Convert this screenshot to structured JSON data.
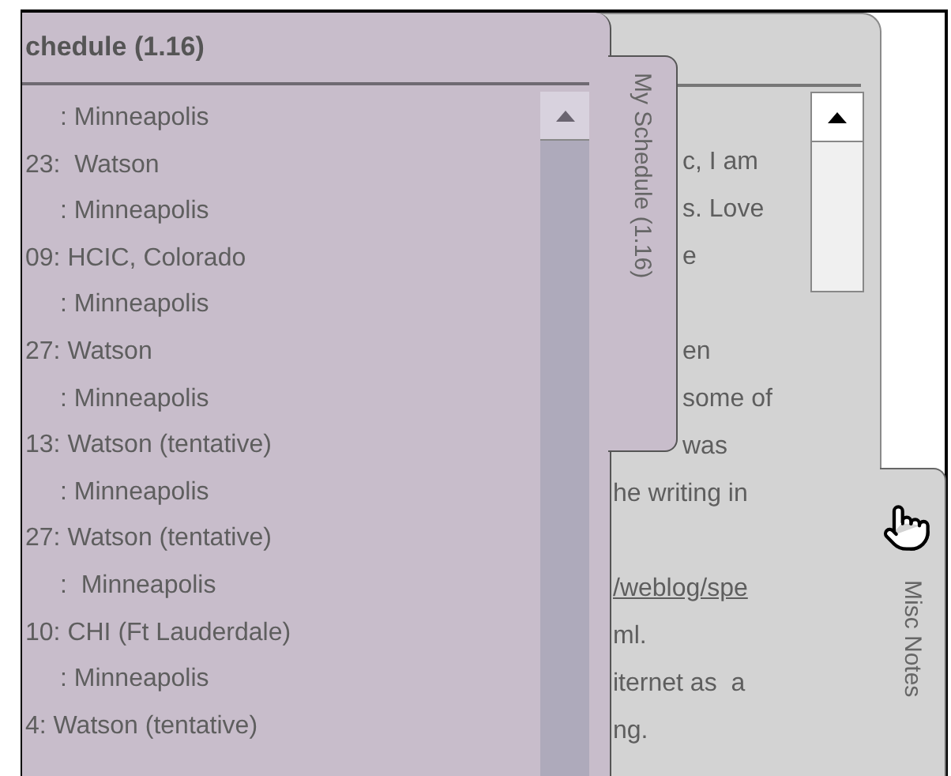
{
  "schedule_panel": {
    "title": "chedule (1.16)",
    "tab_label": "My Schedule (1.16)",
    "entries": [
      {
        "kind": "place",
        "text": ": Minneapolis"
      },
      {
        "kind": "date",
        "text": "23:  Watson"
      },
      {
        "kind": "place",
        "text": ": Minneapolis"
      },
      {
        "kind": "date",
        "text": "09: HCIC, Colorado"
      },
      {
        "kind": "place",
        "text": ": Minneapolis"
      },
      {
        "kind": "date",
        "text": "27: Watson"
      },
      {
        "kind": "place",
        "text": ": Minneapolis"
      },
      {
        "kind": "date",
        "text": "13: Watson (tentative)"
      },
      {
        "kind": "place",
        "text": ": Minneapolis"
      },
      {
        "kind": "date",
        "text": "27: Watson (tentative)"
      },
      {
        "kind": "place",
        "text": ":  Minneapolis"
      },
      {
        "kind": "date",
        "text": "10: CHI (Ft Lauderdale)"
      },
      {
        "kind": "place",
        "text": ": Minneapolis"
      },
      {
        "kind": "date",
        "text": "4: Watson (tentative)"
      }
    ]
  },
  "notes_panel": {
    "tab_label": "Misc Notes",
    "paragraphs": [
      [
        {
          "kind": "text",
          "text": "c, I am"
        },
        {
          "kind": "text",
          "text": "s. Love"
        },
        {
          "kind": "text",
          "text": "e"
        }
      ],
      [
        {
          "kind": "text",
          "text": "en"
        },
        {
          "kind": "text",
          "text": "some of"
        },
        {
          "kind": "text",
          "text": "was"
        },
        {
          "kind": "text",
          "text": "he writing in"
        }
      ],
      [
        {
          "kind": "link",
          "text": "/weblog/spe"
        },
        {
          "kind": "text",
          "text": "ml."
        },
        {
          "kind": "text",
          "text": "iternet as  a"
        },
        {
          "kind": "text",
          "text": "ng."
        }
      ]
    ]
  }
}
